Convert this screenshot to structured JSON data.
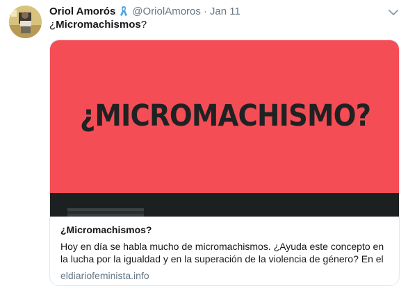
{
  "tweet": {
    "author_name": "Oriol Amorós",
    "author_handle": "@OriolAmoros",
    "separator": "·",
    "date": "Jan 11",
    "text_prefix": "¿",
    "text_bold": "Micromachismos",
    "text_suffix": "?",
    "icons": {
      "ribbon": "awareness-ribbon-icon",
      "caret": "chevron-down-icon"
    }
  },
  "card": {
    "image_text": "¿MICROMACHISMO?",
    "title": "¿Micromachismos?",
    "description_line1": "Hoy en día se habla mucho de micromachismos.  ¿Ayuda este concepto en",
    "description_line2": "la lucha por la igualdad y en la superación de la violencia de género? En el",
    "domain": "eldiariofeminista.info",
    "colors": {
      "image_background": "#f44d56",
      "image_text": "#1f2222",
      "dark_band": "#1c2020"
    }
  }
}
